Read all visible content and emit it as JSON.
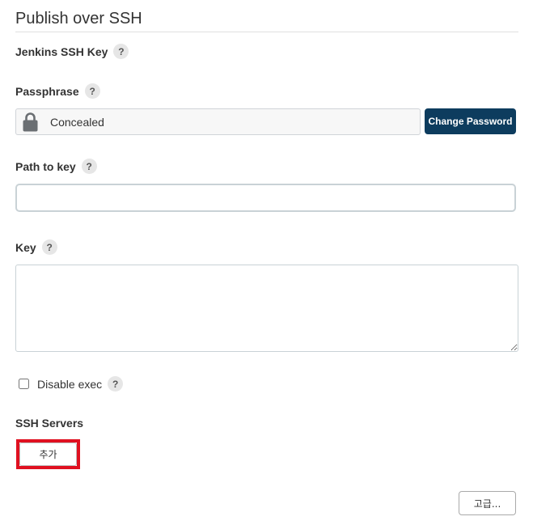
{
  "section": {
    "title": "Publish over SSH"
  },
  "jenkins_ssh_key": {
    "label": "Jenkins SSH Key",
    "help": "?"
  },
  "passphrase": {
    "label": "Passphrase",
    "help": "?",
    "concealed_text": "Concealed",
    "lock_icon": "lock-icon",
    "change_button": "Change Password"
  },
  "path_to_key": {
    "label": "Path to key",
    "help": "?",
    "value": ""
  },
  "key": {
    "label": "Key",
    "help": "?",
    "value": ""
  },
  "disable_exec": {
    "label": "Disable exec",
    "help": "?",
    "checked": false
  },
  "ssh_servers": {
    "label": "SSH Servers",
    "add_button": "추가"
  },
  "advanced_button": "고급...",
  "colors": {
    "primary_button": "#0d3c5e",
    "highlight_frame": "#e01020",
    "help_bg": "#e6e6e6"
  }
}
